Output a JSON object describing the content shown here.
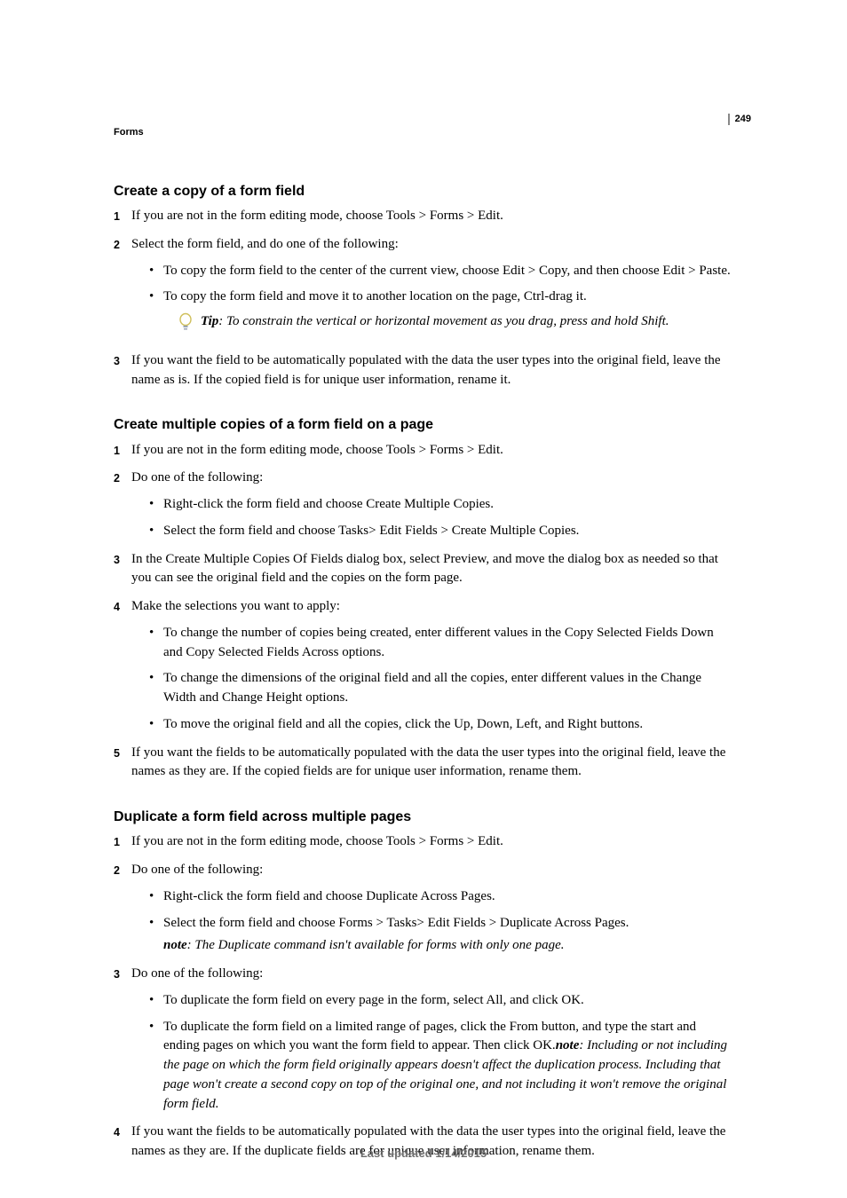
{
  "page_number": "249",
  "chapter": "Forms",
  "footer": "Last updated 1/14/2015",
  "tip_label": "Tip",
  "note_label": "note",
  "sec1": {
    "title": "Create a copy of a form field",
    "s1": "If you are not in the form editing mode, choose Tools > Forms > Edit.",
    "s2": "Select the form field, and do one of the following:",
    "s2a": "To copy the form field to the center of the current view, choose Edit > Copy, and then choose Edit > Paste.",
    "s2b": "To copy the form field and move it to another location on the page, Ctrl-drag it.",
    "tip": ": To constrain the vertical or horizontal movement as you drag, press and hold Shift.",
    "s3": "If you want the field to be automatically populated with the data the user types into the original field, leave the name as is. If the copied field is for unique user information, rename it."
  },
  "sec2": {
    "title": "Create multiple copies of a form field on a page",
    "s1": "If you are not in the form editing mode, choose Tools > Forms > Edit.",
    "s2": "Do one of the following:",
    "s2a": "Right-click the form field and choose Create Multiple Copies.",
    "s2b": "Select the form field and choose Tasks> Edit Fields > Create Multiple Copies.",
    "s3": "In the Create Multiple Copies Of Fields dialog box, select Preview, and move the dialog box as needed so that you can see the original field and the copies on the form page.",
    "s4": "Make the selections you want to apply:",
    "s4a": "To change the number of copies being created, enter different values in the Copy Selected Fields Down and Copy Selected Fields Across options.",
    "s4b": "To change the dimensions of the original field and all the copies, enter different values in the Change Width and Change Height options.",
    "s4c": "To move the original field and all the copies, click the Up, Down, Left, and Right buttons.",
    "s5": "If you want the fields to be automatically populated with the data the user types into the original field, leave the names as they are. If the copied fields are for unique user information, rename them."
  },
  "sec3": {
    "title": "Duplicate a form field across multiple pages",
    "s1": "If you are not in the form editing mode, choose Tools > Forms > Edit.",
    "s2": "Do one of the following:",
    "s2a": "Right-click the form field and choose Duplicate Across Pages.",
    "s2b": "Select the form field and choose Forms > Tasks> Edit Fields > Duplicate Across Pages.",
    "s2note": ": The Duplicate command isn't available for forms with only one page.",
    "s3": "Do one of the following:",
    "s3a": "To duplicate the form field on every page in the form, select All, and click OK.",
    "s3b_pre": "To duplicate the form field on a limited range of pages, click the From button, and type the start and ending pages on which you want the form field to appear. Then click OK.",
    "s3b_post": ": Including or not including the page on which the form field originally appears doesn't affect the duplication process. Including that page won't create a second copy on top of the original one, and not including it won't remove the original form field.",
    "s4": "If you want the fields to be automatically populated with the data the user types into the original field, leave the names as they are. If the duplicate fields are for unique user information, rename them."
  }
}
